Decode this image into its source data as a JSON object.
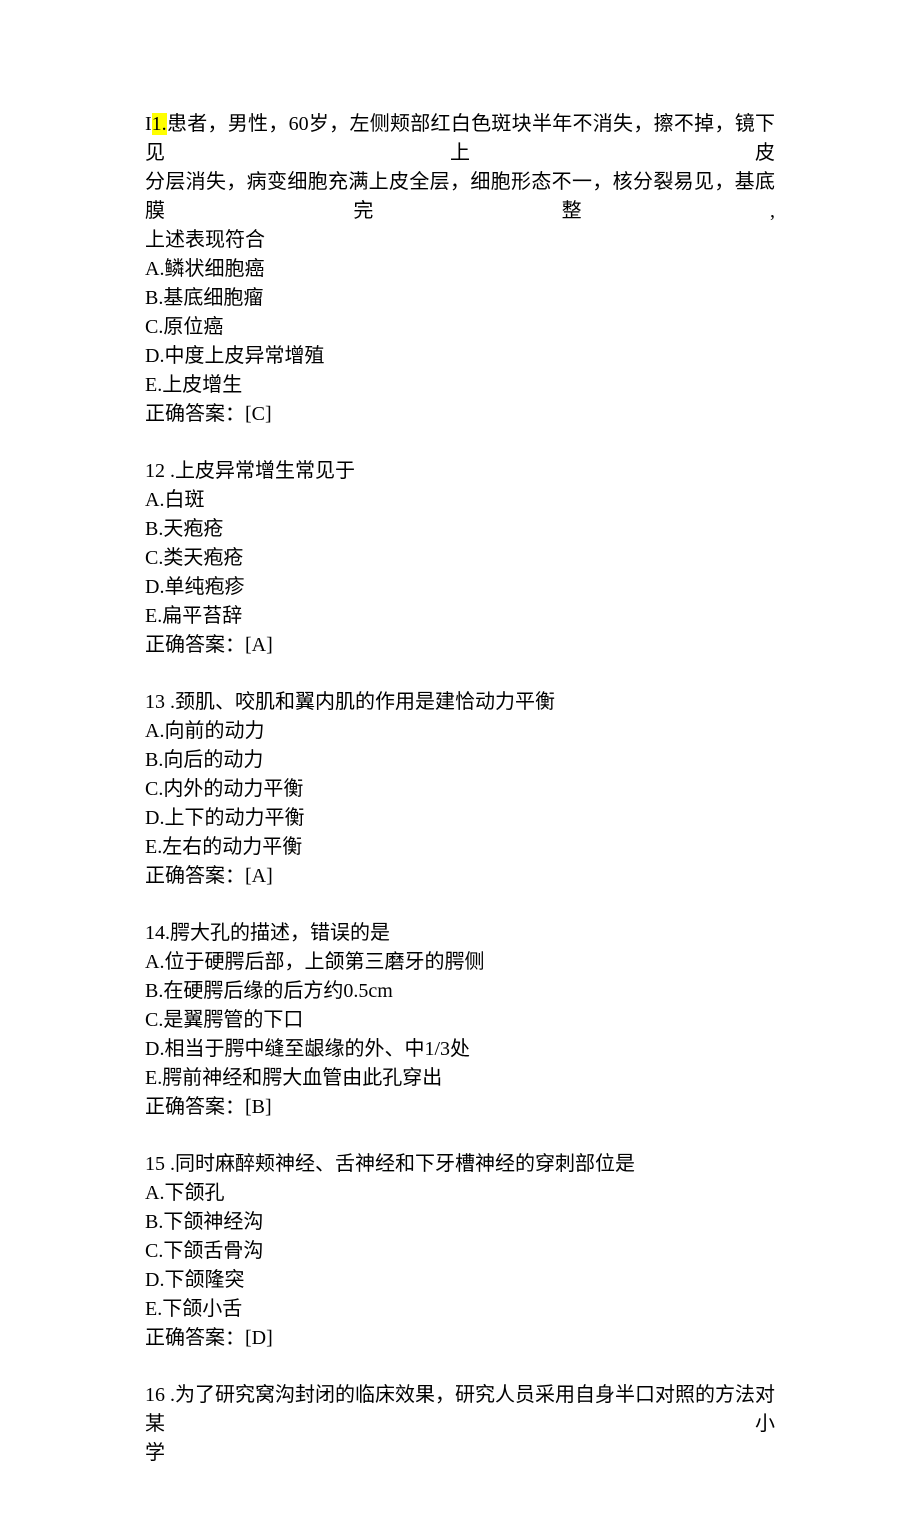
{
  "q11": {
    "num_prefix": "I",
    "num_hl": "1.",
    "stem_l1": "患者，男性，60岁，左侧颊部红白色斑块半年不消失，擦不掉，镜下见上皮",
    "stem_l2": "分层消失，病变细胞充满上皮全层，细胞形态不一，核分裂易见，基底膜完整,",
    "stem_l3": "上述表现符合",
    "a": "A.鳞状细胞癌",
    "b": "B.基底细胞瘤",
    "c": "C.原位癌",
    "d": "D.中度上皮异常增殖",
    "e": "E.上皮增生",
    "ans": "正确答案：[C]"
  },
  "q12": {
    "stem": "12 .上皮异常增生常见于",
    "a": "A.白斑",
    "b": "B.天疱疮",
    "c": "C.类天疱疮",
    "d": "D.单纯疱疹",
    "e": "E.扁平苔辞",
    "ans": "正确答案：[A]"
  },
  "q13": {
    "stem": "13 .颈肌、咬肌和翼内肌的作用是建恰动力平衡",
    "a": "A.向前的动力",
    "b": "B.向后的动力",
    "c": "C.内外的动力平衡",
    "d": "D.上下的动力平衡",
    "e": "E.左右的动力平衡",
    "ans": "正确答案：[A]"
  },
  "q14": {
    "stem": "14.腭大孔的描述，错误的是",
    "a": "A.位于硬腭后部，上颌第三磨牙的腭侧",
    "b": "B.在硬腭后缘的后方约0.5cm",
    "c": "C.是翼腭管的下口",
    "d": "D.相当于腭中缝至龈缘的外、中1/3处",
    "e": "E.腭前神经和腭大血管由此孔穿出",
    "ans": "正确答案：[B]"
  },
  "q15": {
    "stem": "15 .同时麻醉颊神经、舌神经和下牙槽神经的穿刺部位是",
    "a": "A.下颌孔",
    "b": "B.下颌神经沟",
    "c": "C.下颌舌骨沟",
    "d": "D.下颌隆突",
    "e": "E.下颌小舌",
    "ans": "正确答案：[D]"
  },
  "q16": {
    "stem_l1": "16 .为了研究窝沟封闭的临床效果，研究人员采用自身半口对照的方法对某小",
    "stem_l2": "学"
  }
}
